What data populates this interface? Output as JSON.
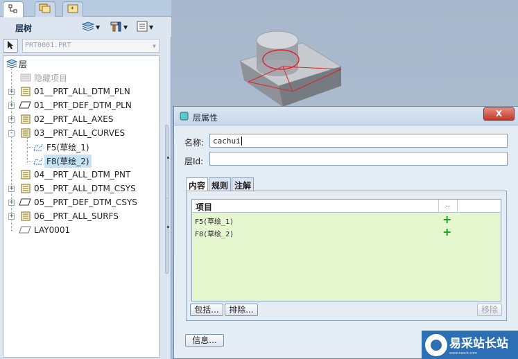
{
  "left_panel": {
    "title": "层树",
    "model_selector": "PRT0001.PRT",
    "tree": {
      "root": "层",
      "items": [
        {
          "label": "隐藏项目",
          "level": 1,
          "expander": "",
          "greyed": true
        },
        {
          "label": "01__PRT_ALL_DTM_PLN",
          "level": 1,
          "expander": "+"
        },
        {
          "label": "01__PRT_DEF_DTM_PLN",
          "level": 1,
          "expander": "+"
        },
        {
          "label": "02__PRT_ALL_AXES",
          "level": 1,
          "expander": "+"
        },
        {
          "label": "03__PRT_ALL_CURVES",
          "level": 1,
          "expander": "-"
        },
        {
          "label": "F5(草绘_1)",
          "level": 2,
          "expander": ""
        },
        {
          "label": "F8(草绘_2)",
          "level": 2,
          "expander": "",
          "selected": true
        },
        {
          "label": "04__PRT_ALL_DTM_PNT",
          "level": 1,
          "expander": ""
        },
        {
          "label": "05__PRT_ALL_DTM_CSYS",
          "level": 1,
          "expander": "+"
        },
        {
          "label": "05__PRT_DEF_DTM_CSYS",
          "level": 1,
          "expander": "+"
        },
        {
          "label": "06__PRT_ALL_SURFS",
          "level": 1,
          "expander": "+"
        },
        {
          "label": "LAY0001",
          "level": 1,
          "expander": ""
        }
      ]
    }
  },
  "dialog": {
    "title": "层属性",
    "close_label": "X",
    "name_label": "名称:",
    "name_value": "cachui",
    "id_label": "层Id:",
    "id_value": "",
    "tabs": [
      "内容",
      "规则",
      "注解"
    ],
    "list": {
      "col_item": "项目",
      "col_status": "..",
      "rows": [
        {
          "name": "F5(草绘_1)",
          "status": "+"
        },
        {
          "name": "F8(草绘_2)",
          "status": "+"
        }
      ]
    },
    "include_label": "包括...",
    "exclude_label": "排除...",
    "remove_label": "移除",
    "info_label": "信息..."
  },
  "watermark": {
    "text": "易采站长站",
    "sub": "www.easck.com"
  },
  "colors": {
    "list_background": "#e4f7cf",
    "plus": "#1a9b1a",
    "close_button": "#c0392b",
    "model_top": "#c7cacf",
    "model_side": "#8e9298",
    "sketch": "#e0202a"
  }
}
